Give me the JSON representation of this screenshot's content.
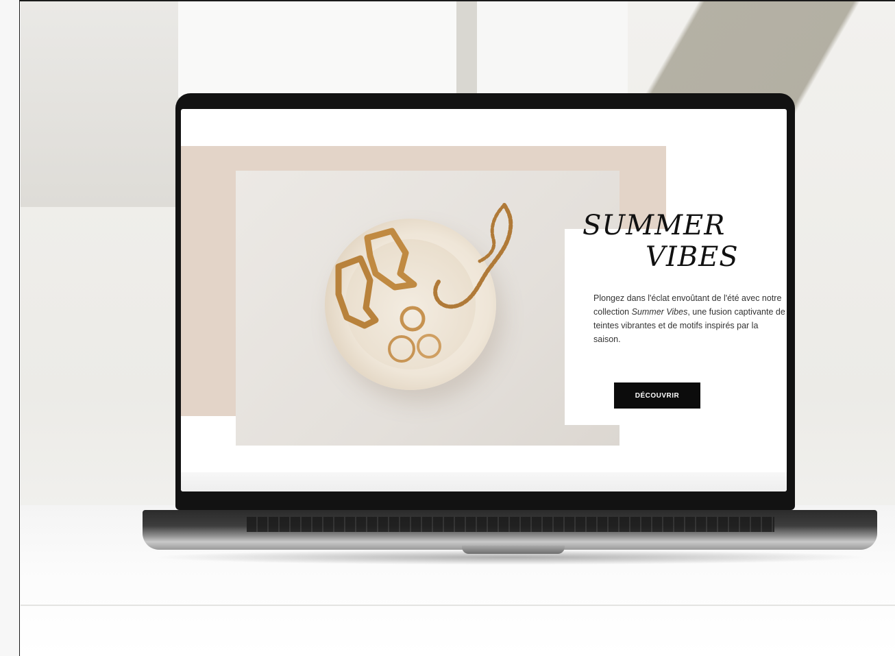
{
  "website": {
    "headline_line1": "SUMMER",
    "headline_line2": "VIBES",
    "body_part1": "Plongez dans l'éclat envoûtant de l'été avec notre collection ",
    "body_italic": "Summer Vibes",
    "body_part2": ", une fusion captivante de teintes vibrantes et de motifs inspirés par la saison.",
    "cta_label": "DÉCOUVRIR"
  },
  "colors": {
    "blush": "#e3d4c8",
    "text": "#111111",
    "button": "#0c0c0c",
    "gold": "#b8823c"
  }
}
